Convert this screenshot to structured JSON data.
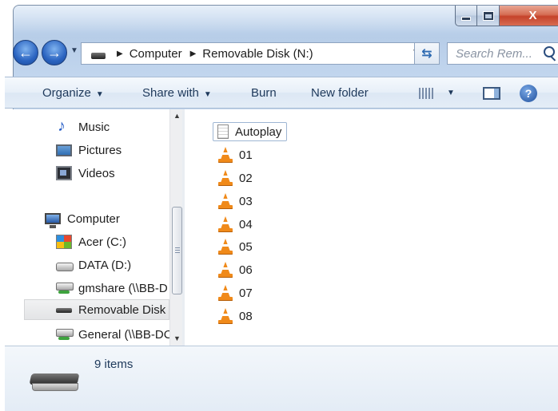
{
  "titlebar": {
    "caption_buttons": [
      "minimize",
      "maximize",
      "close"
    ],
    "close_glyph": "X"
  },
  "navigation": {
    "back_icon": "back-arrow-icon",
    "forward_icon": "forward-arrow-icon",
    "breadcrumbs": [
      "Computer",
      "Removable Disk (N:)"
    ],
    "search_placeholder": "Search Rem..."
  },
  "toolbar": {
    "organize": "Organize",
    "share_with": "Share with",
    "burn": "Burn",
    "new_folder": "New folder",
    "help_glyph": "?"
  },
  "sidebar": {
    "items": [
      {
        "label": "Music",
        "icon": "music-icon"
      },
      {
        "label": "Pictures",
        "icon": "pictures-icon"
      },
      {
        "label": "Videos",
        "icon": "videos-icon"
      },
      {
        "label": "Computer",
        "icon": "computer-icon"
      },
      {
        "label": "Acer (C:)",
        "icon": "windows-drive-icon"
      },
      {
        "label": "DATA (D:)",
        "icon": "hard-drive-icon"
      },
      {
        "label": "gmshare (\\\\BB-D",
        "icon": "network-drive-icon"
      },
      {
        "label": "Removable Disk (",
        "icon": "removable-disk-icon",
        "selected": true
      },
      {
        "label": "General (\\\\BB-DC",
        "icon": "network-drive-icon"
      }
    ]
  },
  "files": [
    {
      "name": "Autoplay",
      "icon": "text-file-icon"
    },
    {
      "name": "01",
      "icon": "vlc-cone-icon"
    },
    {
      "name": "02",
      "icon": "vlc-cone-icon"
    },
    {
      "name": "03",
      "icon": "vlc-cone-icon"
    },
    {
      "name": "04",
      "icon": "vlc-cone-icon"
    },
    {
      "name": "05",
      "icon": "vlc-cone-icon"
    },
    {
      "name": "06",
      "icon": "vlc-cone-icon"
    },
    {
      "name": "07",
      "icon": "vlc-cone-icon"
    },
    {
      "name": "08",
      "icon": "vlc-cone-icon"
    }
  ],
  "details": {
    "item_count": "9 items"
  },
  "colors": {
    "accent": "#2a63c0",
    "close_button": "#c5432b",
    "vlc_orange": "#f08a1a"
  }
}
